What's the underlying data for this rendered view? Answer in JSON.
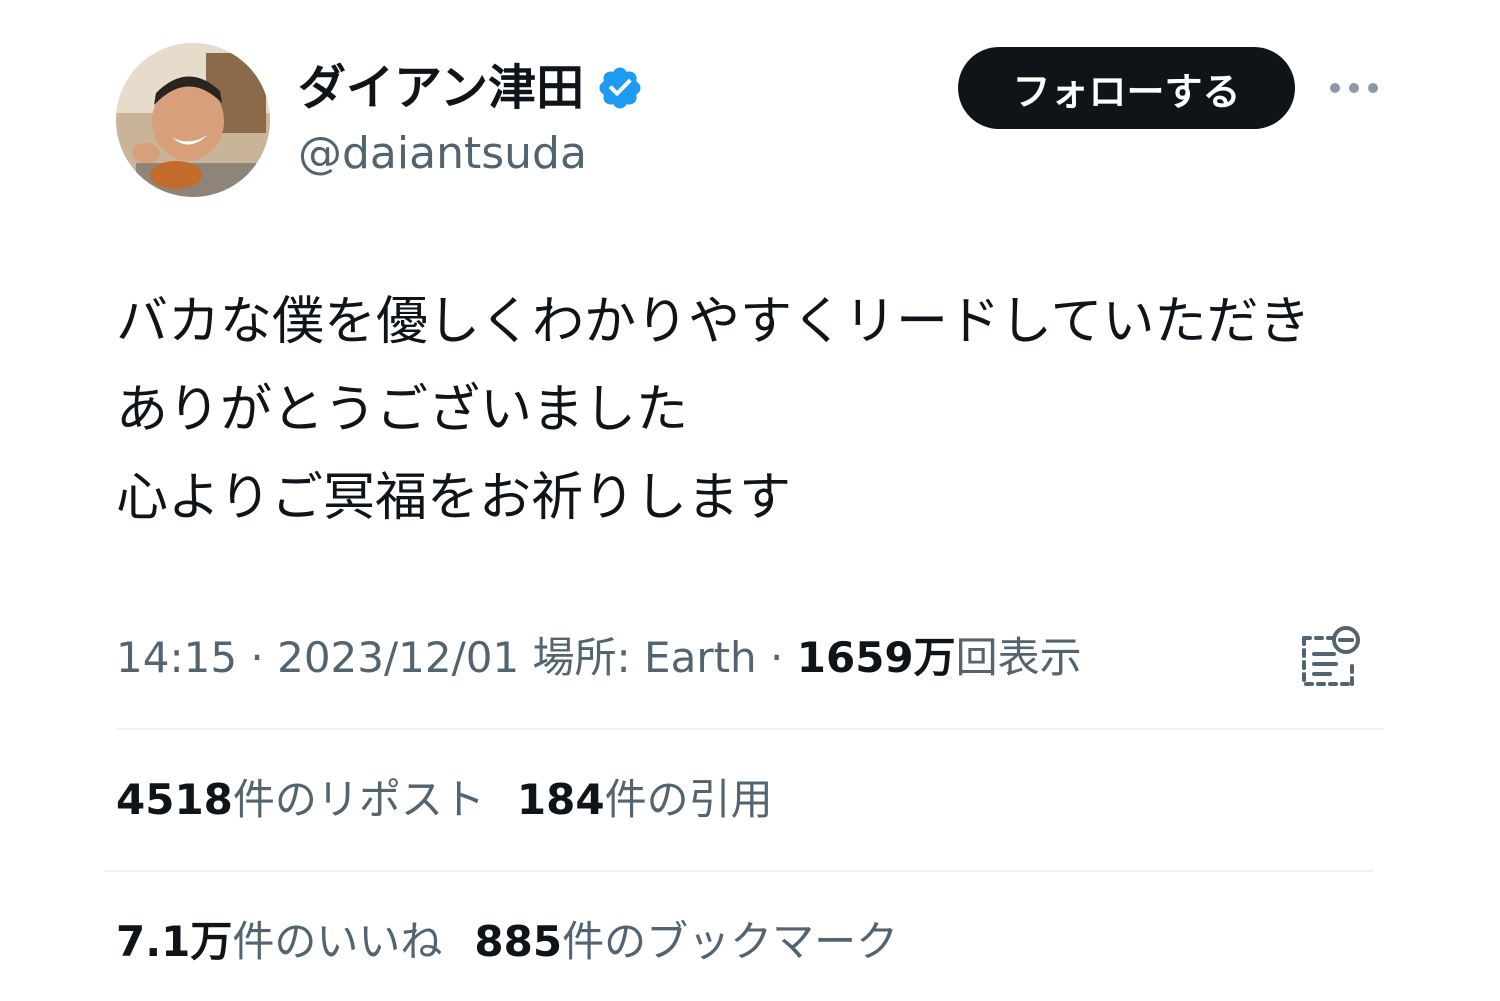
{
  "author": {
    "display_name": "ダイアン津田",
    "handle": "@daiantsuda",
    "verified": true,
    "avatar_icon": "avatar-photo"
  },
  "actions": {
    "follow_label": "フォローする",
    "more_icon": "more-dots-icon"
  },
  "tweet": {
    "lines": [
      "バカな僕を優しくわかりやすくリードしていただき",
      "ありがとうございました",
      "心よりご冥福をお祈りします"
    ]
  },
  "meta": {
    "time": "14:15",
    "separator": " · ",
    "date": "2023/12/01",
    "location": "場所: Earth",
    "views_count": "1659万",
    "views_label": "回表示"
  },
  "stats": {
    "reposts_count": "4518",
    "reposts_label": "件のリポスト",
    "quotes_count": "184",
    "quotes_label": "件の引用",
    "likes_count": "7.1万",
    "likes_label": "件のいいね",
    "bookmarks_count": "885",
    "bookmarks_label": "件のブックマーク"
  },
  "colors": {
    "text_primary": "#0f1419",
    "text_secondary": "#536471",
    "verified_blue": "#1d9bf0",
    "divider": "#eff3f4",
    "follow_bg": "#0f1419"
  }
}
